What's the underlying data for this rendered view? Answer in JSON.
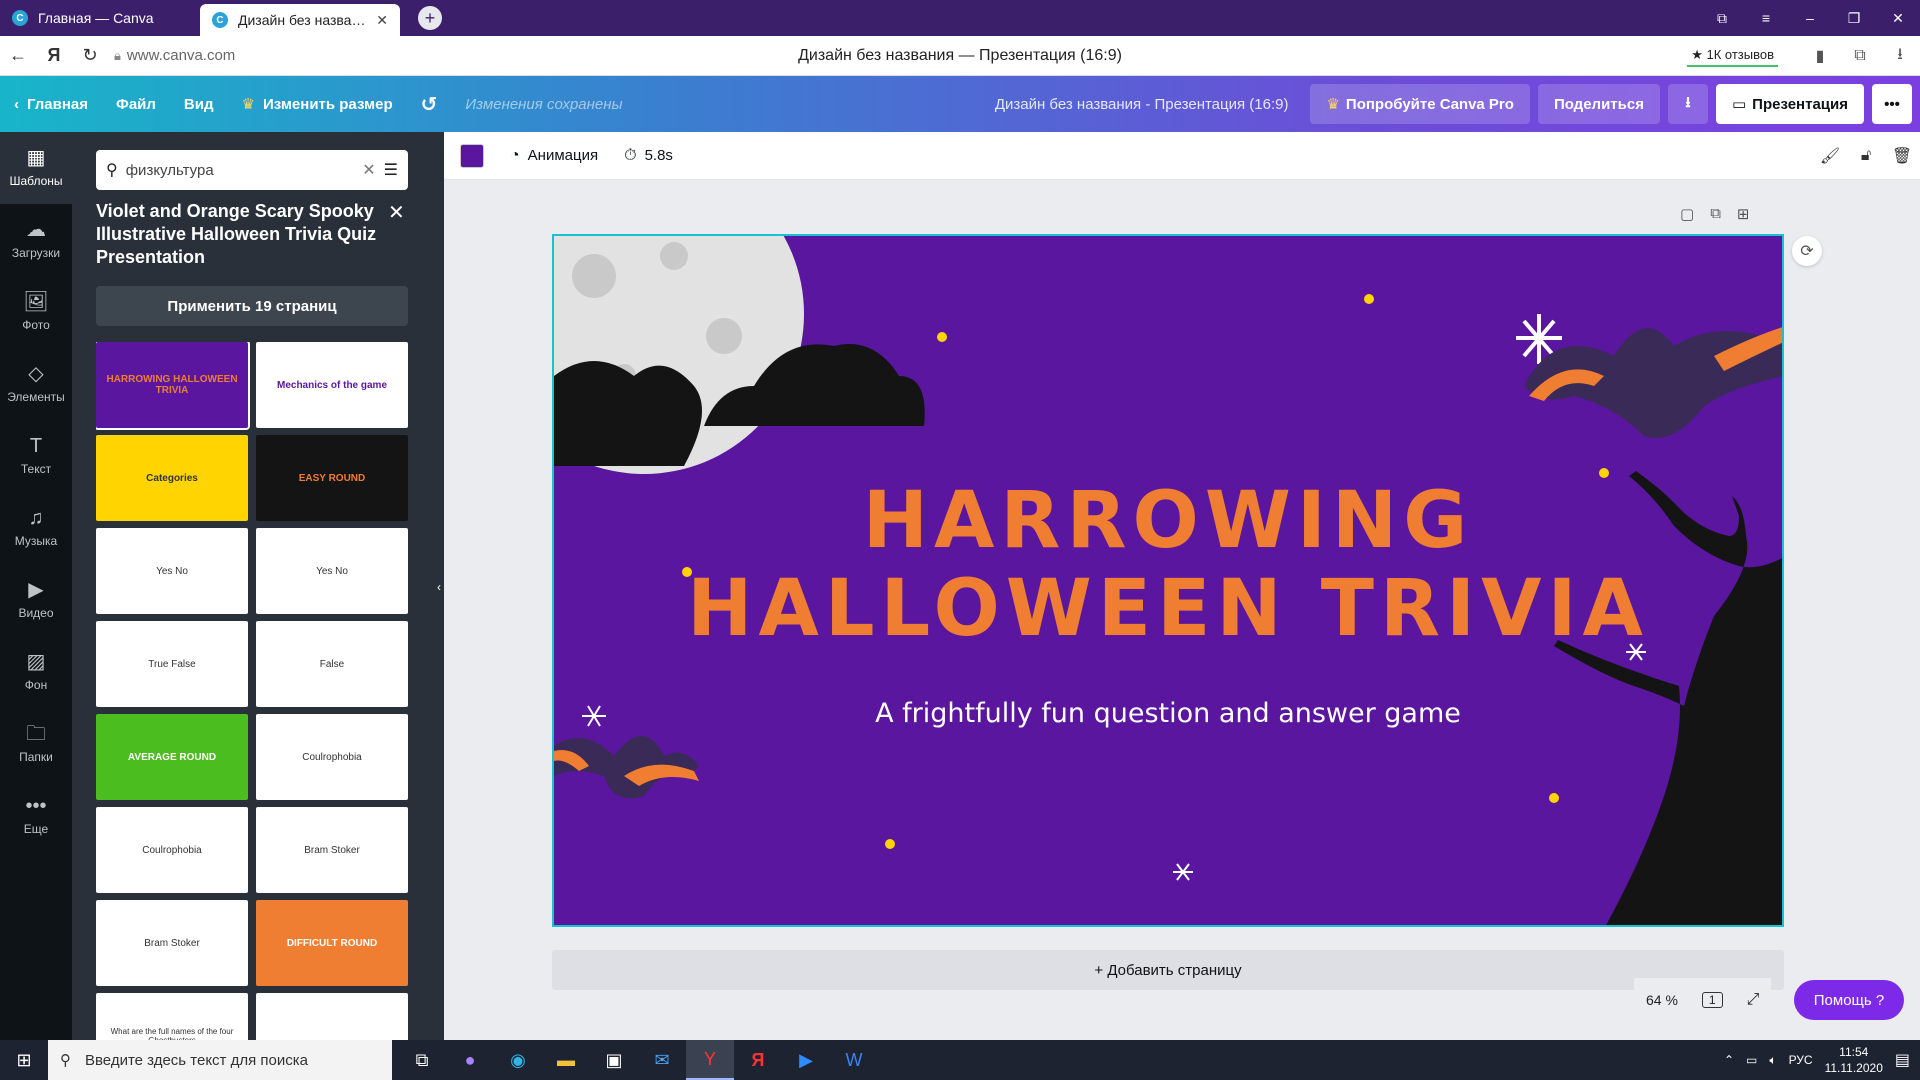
{
  "browser": {
    "tabs": [
      {
        "label": "Главная — Canva",
        "active": false
      },
      {
        "label": "Дизайн без названия — Canva",
        "active": true
      }
    ],
    "url": "www.canva.com",
    "page_title": "Дизайн без названия — Презентация (16:9)",
    "reviews": "★ 1К отзывов"
  },
  "topbar": {
    "home": "Главная",
    "file": "Файл",
    "view": "Вид",
    "resize": "Изменить размер",
    "saved": "Изменения сохранены",
    "doc_title": "Дизайн без названия - Презентация (16:9)",
    "try_pro": "Попробуйте Canva Pro",
    "share": "Поделиться",
    "present": "Презентация"
  },
  "rail": [
    {
      "label": "Шаблоны",
      "icon": "templates-icon"
    },
    {
      "label": "Загрузки",
      "icon": "upload-icon"
    },
    {
      "label": "Фото",
      "icon": "photo-icon"
    },
    {
      "label": "Элементы",
      "icon": "elements-icon"
    },
    {
      "label": "Текст",
      "icon": "text-icon"
    },
    {
      "label": "Музыка",
      "icon": "music-icon"
    },
    {
      "label": "Видео",
      "icon": "video-icon"
    },
    {
      "label": "Фон",
      "icon": "background-icon"
    },
    {
      "label": "Папки",
      "icon": "folder-icon"
    },
    {
      "label": "Еще",
      "icon": "more-icon"
    }
  ],
  "panel": {
    "search_value": "физкультура",
    "template_title": "Violet and Orange Scary Spooky Illustrative Halloween Trivia Quiz Presentation",
    "apply_label": "Применить 19 страниц",
    "thumbs": [
      {
        "text": "HARROWING HALLOWEEN TRIVIA"
      },
      {
        "text": "Mechanics of the game"
      },
      {
        "text": "Categories"
      },
      {
        "text": "EASY ROUND"
      },
      {
        "text": "Yes   No"
      },
      {
        "text": "Yes   No"
      },
      {
        "text": "True   False"
      },
      {
        "text": "False"
      },
      {
        "text": "AVERAGE ROUND"
      },
      {
        "text": "Coulrophobia"
      },
      {
        "text": "Coulrophobia"
      },
      {
        "text": "Bram Stoker"
      },
      {
        "text": "Bram Stoker"
      },
      {
        "text": "DIFFICULT ROUND"
      },
      {
        "text": "What are the full names of the four Ghostbusters"
      },
      {
        "text": ""
      }
    ]
  },
  "toolbar": {
    "color": "#5a169f",
    "animation": "Анимация",
    "duration": "5.8s"
  },
  "slide": {
    "title_line1": "HARROWING",
    "title_line2": "HALLOWEEN TRIVIA",
    "subtitle": "A frightfully fun question and answer game"
  },
  "canvas": {
    "add_page": "+ Добавить страницу",
    "zoom": "64 %",
    "page_num": "1",
    "help": "Помощь ?"
  },
  "taskbar": {
    "search_placeholder": "Введите здесь текст для поиска",
    "lang": "РУС",
    "time": "11:54",
    "date": "11.11.2020"
  }
}
